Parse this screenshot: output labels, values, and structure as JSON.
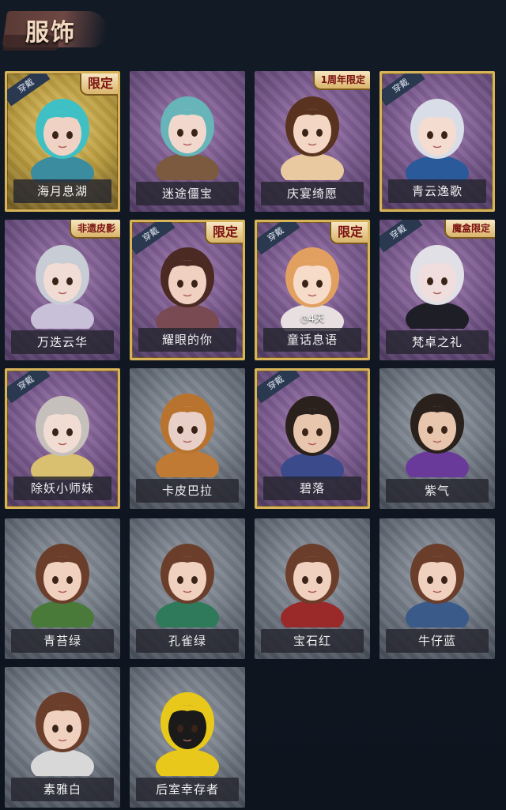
{
  "header": {
    "title": "服饰"
  },
  "cards": [
    {
      "name": "海月息湖",
      "style": "gold-full",
      "badge": "穿戴",
      "ribbon": "限定",
      "hair": "#3fc0c4",
      "skin": "#f0d2c4",
      "cloth": "#3a8c9e"
    },
    {
      "name": "迷途僵宝",
      "style": "purple",
      "badge": "",
      "ribbon": "",
      "hair": "#67b4b9",
      "skin": "#f2d8cc",
      "cloth": "#7b5a40"
    },
    {
      "name": "庆宴绮愿",
      "style": "purple",
      "badge": "",
      "ribbon": "1周年限定",
      "hair": "#5a3220",
      "skin": "#f3d6c4",
      "cloth": "#e9c9a0"
    },
    {
      "name": "青云逸歌",
      "style": "gold",
      "badge": "穿戴",
      "ribbon": "",
      "hair": "#d8dde8",
      "skin": "#f4dcd0",
      "cloth": "#2b5a9a"
    },
    {
      "name": "万迭云华",
      "style": "purple",
      "badge": "",
      "ribbon": "非遗皮影",
      "hair": "#c8ccd4",
      "skin": "#f0dcd4",
      "cloth": "#c8c0d8"
    },
    {
      "name": "耀眼的你",
      "style": "gold",
      "badge": "穿戴",
      "ribbon": "限定",
      "hair": "#4a2a22",
      "skin": "#f0d0c0",
      "cloth": "#7a4a52"
    },
    {
      "name": "童话息语",
      "style": "gold",
      "badge": "穿戴",
      "ribbon": "限定",
      "hair": "#e2a060",
      "skin": "#f6dcc8",
      "cloth": "#e8e0e0",
      "timer": "◷4天"
    },
    {
      "name": "梵卓之礼",
      "style": "purple",
      "badge": "穿戴",
      "ribbon": "魔盒限定",
      "hair": "#e0e0e6",
      "skin": "#f0dede",
      "cloth": "#1e1e26"
    },
    {
      "name": "除妖小师妹",
      "style": "gold",
      "badge": "穿戴",
      "ribbon": "",
      "hair": "#c6c0bc",
      "skin": "#f0dcd2",
      "cloth": "#d8c070"
    },
    {
      "name": "卡皮巴拉",
      "style": "gray",
      "badge": "",
      "ribbon": "",
      "hair": "#b8742e",
      "skin": "#e8cfc8",
      "cloth": "#c07a34"
    },
    {
      "name": "碧落",
      "style": "gold",
      "badge": "穿戴",
      "ribbon": "",
      "hair": "#2a201c",
      "skin": "#e8c6ae",
      "cloth": "#3a4a8a"
    },
    {
      "name": "紫气",
      "style": "gray",
      "badge": "",
      "ribbon": "",
      "hair": "#2a201c",
      "skin": "#e8c6ae",
      "cloth": "#6a3a9a"
    },
    {
      "name": "青苔绿",
      "style": "gray",
      "badge": "",
      "ribbon": "",
      "hair": "#6a3e2a",
      "skin": "#f0d0be",
      "cloth": "#4a7a3a"
    },
    {
      "name": "孔雀绿",
      "style": "gray",
      "badge": "",
      "ribbon": "",
      "hair": "#6a3e2a",
      "skin": "#f0d0be",
      "cloth": "#2e7a5a"
    },
    {
      "name": "宝石红",
      "style": "gray",
      "badge": "",
      "ribbon": "",
      "hair": "#6a3e2a",
      "skin": "#f0d0be",
      "cloth": "#9a2a2a"
    },
    {
      "name": "牛仔蓝",
      "style": "gray",
      "badge": "",
      "ribbon": "",
      "hair": "#6a3e2a",
      "skin": "#f0d0be",
      "cloth": "#3a5a8a"
    },
    {
      "name": "素雅白",
      "style": "gray",
      "badge": "",
      "ribbon": "",
      "hair": "#6a3e2a",
      "skin": "#f0d0be",
      "cloth": "#d8d8d8"
    },
    {
      "name": "后室幸存者",
      "style": "gray",
      "badge": "",
      "ribbon": "",
      "hair": "#e8c81a",
      "skin": "#1a1a1a",
      "cloth": "#e8c81a"
    }
  ]
}
